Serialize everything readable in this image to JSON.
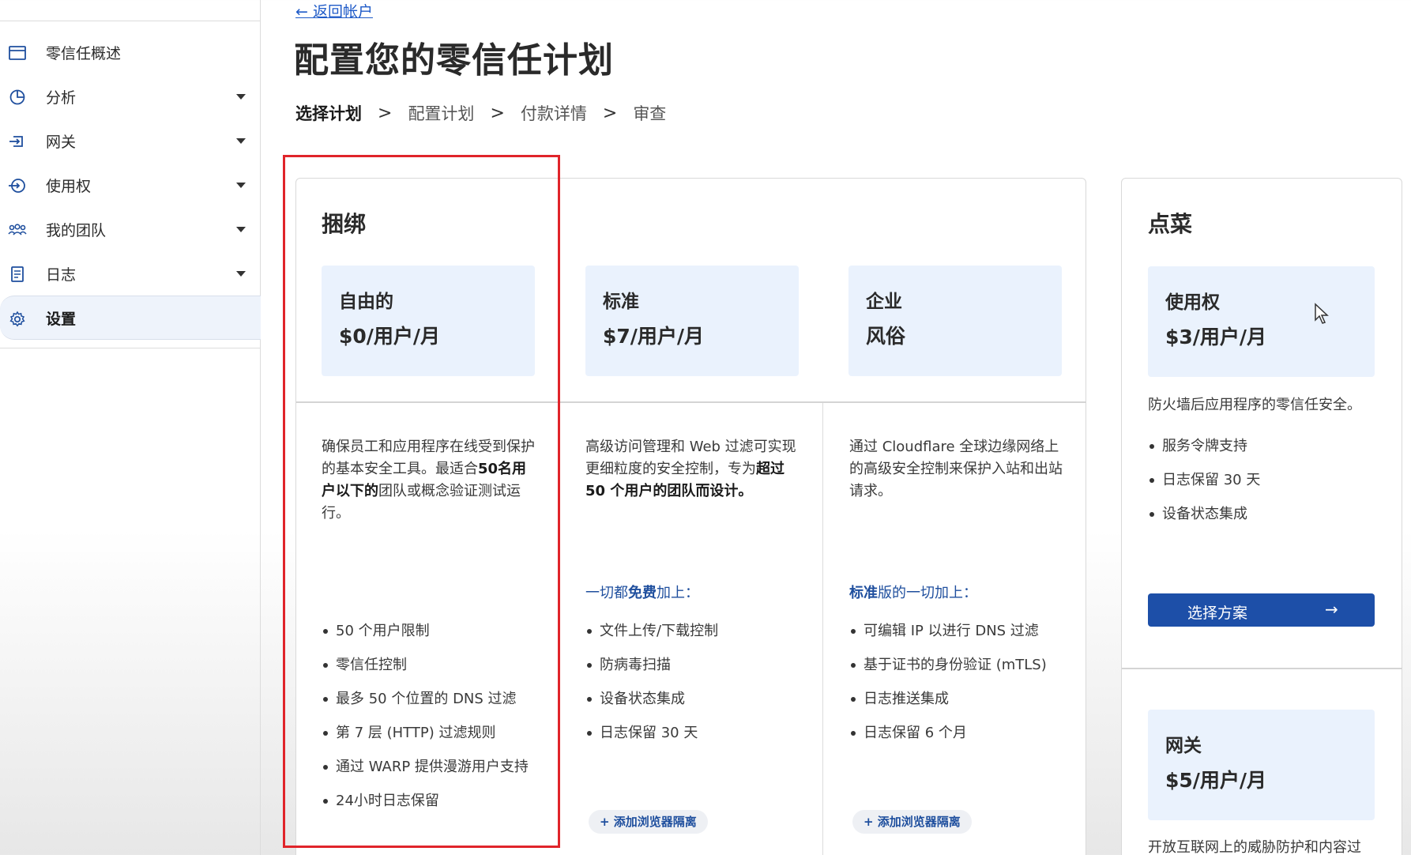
{
  "sidebar": {
    "items": [
      {
        "label": "零信任概述",
        "has_caret": false,
        "active": false
      },
      {
        "label": "分析",
        "has_caret": true,
        "active": false
      },
      {
        "label": "网关",
        "has_caret": true,
        "active": false
      },
      {
        "label": "使用权",
        "has_caret": true,
        "active": false
      },
      {
        "label": "我的团队",
        "has_caret": true,
        "active": false
      },
      {
        "label": "日志",
        "has_caret": true,
        "active": false
      },
      {
        "label": "设置",
        "has_caret": false,
        "active": true
      }
    ]
  },
  "main": {
    "back_link": "← 返回帐户",
    "title": "配置您的零信任计划",
    "steps": [
      "选择计划",
      "配置计划",
      "付款详情",
      "审查"
    ],
    "current_step": "选择计划"
  },
  "bundle": {
    "title": "捆绑",
    "plans": [
      {
        "name": "自由的",
        "price": "$0/用户/月",
        "desc_parts": [
          "确保员工和应用程序在线受到保护的基本安全工具。最适合",
          "50名用户以下的",
          "团队或概念验证测试运行。"
        ],
        "plus_head": null,
        "features": [
          "50 个用户限制",
          "零信任控制",
          "最多 50 个位置的 DNS 过滤",
          "第 7 层 (HTTP) 过滤规则",
          "通过 WARP 提供漫游用户支持",
          "24小时日志保留"
        ],
        "addon": null
      },
      {
        "name": "标准",
        "price": "$7/用户/月",
        "desc_parts": [
          "高级访问管理和 Web 过滤可实现更细粒度的安全控制，专为",
          "超过 50 个用户的团队而设计。",
          ""
        ],
        "plus_head": {
          "pre": "一切都",
          "bold": "免费",
          "post": "加上："
        },
        "features": [
          "文件上传/下载控制",
          "防病毒扫描",
          "设备状态集成",
          "日志保留 30 天"
        ],
        "addon": "+ 添加浏览器隔离"
      },
      {
        "name": "企业",
        "price": "风俗",
        "desc_parts": [
          "通过 Cloudflare 全球边缘网络上的高级安全控制来保护入站和出站请求。",
          "",
          ""
        ],
        "plus_head": {
          "pre": "",
          "bold": "标准",
          "post": "版的一切加上："
        },
        "features": [
          "可编辑 IP 以进行 DNS 过滤",
          "基于证书的身份验证 (mTLS)",
          "日志推送集成",
          "日志保留 6 个月"
        ],
        "addon": "+ 添加浏览器隔离"
      }
    ]
  },
  "alacarte": {
    "title": "点菜",
    "plan1": {
      "name": "使用权",
      "price": "$3/用户/月",
      "desc": "防火墙后应用程序的零信任安全。",
      "features": [
        "服务令牌支持",
        "日志保留 30 天",
        "设备状态集成"
      ],
      "button": "选择方案",
      "button_arrow": "→"
    },
    "plan2": {
      "name": "网关",
      "price": "$5/用户/月",
      "desc": "开放互联网上的威胁防护和内容过"
    }
  },
  "colors": {
    "accent": "#1d4fa8",
    "link": "#1f5bc8",
    "highlight": "#e0242a",
    "plan_box": "#eaf2fd"
  }
}
